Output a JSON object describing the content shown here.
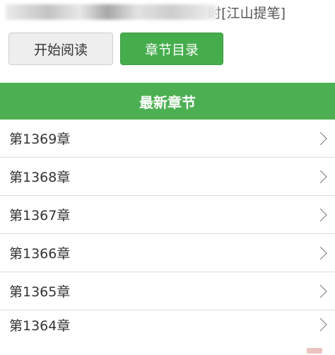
{
  "top_title": {
    "visible_text": "时[江山提笔]"
  },
  "buttons": {
    "start_reading": "开始阅读",
    "catalog": "章节目录"
  },
  "section": {
    "title": "最新章节"
  },
  "chapters": [
    {
      "label": "第1369章"
    },
    {
      "label": "第1368章"
    },
    {
      "label": "第1367章"
    },
    {
      "label": "第1366章"
    },
    {
      "label": "第1365章"
    },
    {
      "label": "第1364章"
    }
  ],
  "icons": {
    "row_arrow": "chevron-right-icon"
  },
  "colors": {
    "accent_green": "#4cb052",
    "button_green": "#45ad4c",
    "button_gray": "#eeeeee",
    "text": "#333333",
    "divider": "#dcdcdc"
  }
}
